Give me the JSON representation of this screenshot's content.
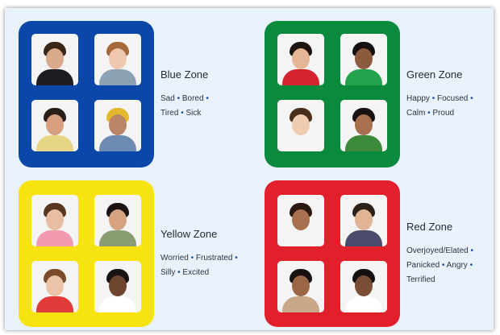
{
  "zones": {
    "blue": {
      "title": "Blue Zone",
      "color": "#0a47a8",
      "items": [
        "Sad",
        "Bored",
        "Tired",
        "Sick"
      ]
    },
    "green": {
      "title": "Green Zone",
      "color": "#0a8a3c",
      "items": [
        "Happy",
        "Focused",
        "Calm",
        "Proud"
      ]
    },
    "yellow": {
      "title": "Yellow Zone",
      "color": "#f8e312",
      "items": [
        "Worried",
        "Frustrated",
        "Silly",
        "Excited"
      ]
    },
    "red": {
      "title": "Red Zone",
      "color": "#e2202b",
      "items": [
        "Overjoyed/Elated",
        "Panicked",
        "Angry",
        "Terrified"
      ]
    }
  },
  "separator": "•"
}
